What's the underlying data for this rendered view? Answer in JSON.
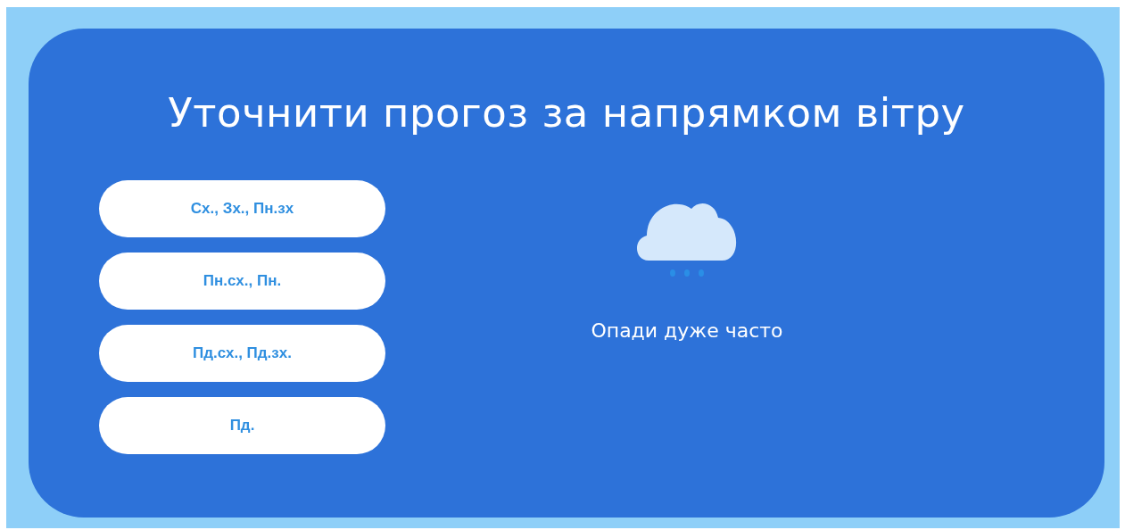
{
  "title": "Уточнити прогоз за напрямком вітру",
  "options": [
    {
      "label": "Сх., Зх., Пн.зх"
    },
    {
      "label": "Пн.сх., Пн."
    },
    {
      "label": "Пд.сх., Пд.зх."
    },
    {
      "label": "Пд."
    }
  ],
  "result": {
    "text": "Опади дуже часто"
  }
}
